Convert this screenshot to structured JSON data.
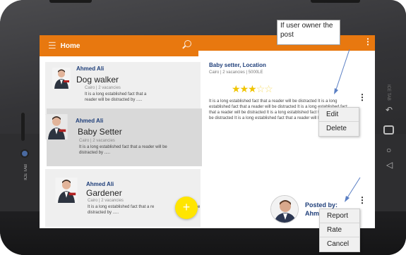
{
  "app_bar": {
    "title": "Home"
  },
  "listings": [
    {
      "name": "Ahmed Ali",
      "role": "Dog walker",
      "meta": "Cairo | 2 vacancies",
      "desc_line1": "It is a long established fact that a",
      "desc_line2": "reader will be distracted by ....."
    },
    {
      "name": "Ahmed Ali",
      "role": "Baby Setter",
      "meta": "Cairo | 2 vacancies",
      "desc_line1": "It is a long established fact that a reader will be",
      "desc_line2": "distracted by ....."
    },
    {
      "name": "Ahmed Ali",
      "role": "Gardener",
      "meta": "Cairo | 2 vacancies",
      "desc_line1": "It is a long established fact that a re",
      "desc_line1_tail": "e",
      "desc_line2": "distracted by ....."
    }
  ],
  "detail": {
    "title": "Baby setter, Location",
    "meta": "Cairo | 2 vacancies | 5000LE",
    "rating": 3,
    "rating_max": 5,
    "description": "It is a long established fact that a reader will be distracted It is a long established fact that a reader will be distracted It is a long established fact that a reader will be distracted It is a long established fact that a reader will be distracted It is a long established fact that a reader will be distracted"
  },
  "annotation": {
    "text": "If user owner the post"
  },
  "owner_menu": [
    "Edit",
    "Delete"
  ],
  "poster": {
    "label": "Posted by:",
    "name": "Ahm"
  },
  "poster_menu": [
    "Report",
    "Rate",
    "Cancel"
  ],
  "fab": {
    "label": "+"
  },
  "device": {
    "brand_left": "ICE TAB",
    "brand_right": "ICE TAB"
  },
  "colors": {
    "accent": "#e8780f",
    "name": "#1f3f7a",
    "fab": "#ffe500",
    "star": "#f0c400"
  }
}
